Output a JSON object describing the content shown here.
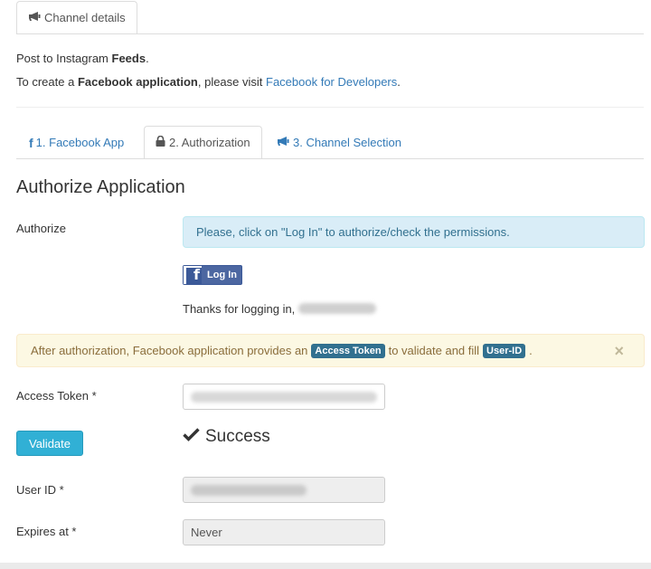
{
  "header_tab": {
    "label": "Channel details",
    "icon": "bullhorn-icon"
  },
  "intro": {
    "line1_prefix": "Post to Instagram ",
    "line1_bold": "Feeds",
    "line1_suffix": ".",
    "line2_prefix": "To create a ",
    "line2_bold": "Facebook application",
    "line2_mid": ", please visit ",
    "line2_link": "Facebook for Developers",
    "line2_suffix": "."
  },
  "wizard_tabs": [
    {
      "label": "1. Facebook App",
      "icon": "facebook-icon"
    },
    {
      "label": "2. Authorization",
      "icon": "lock-icon"
    },
    {
      "label": "3. Channel Selection",
      "icon": "bullhorn-icon"
    }
  ],
  "section_title": "Authorize Application",
  "authorize": {
    "label": "Authorize",
    "info": "Please, click on \"Log In\" to authorize/check the permissions.",
    "fb_button": "Log In",
    "thanks": "Thanks for logging in, "
  },
  "warning": {
    "text_prefix": "After authorization, Facebook application provides an ",
    "token_label": "Access Token",
    "text_mid": " to validate and fill ",
    "userid_label": "User-ID",
    "text_suffix": ".",
    "close": "×"
  },
  "access_token": {
    "label": "Access Token *"
  },
  "validate_button": "Validate",
  "status": "Success",
  "user_id": {
    "label": "User ID *"
  },
  "expires": {
    "label": "Expires at *",
    "value": "Never"
  },
  "colors": {
    "link": "#337ab7",
    "info_bg": "#d9edf7",
    "warn_bg": "#fcf8e3",
    "button": "#31b0d5"
  }
}
